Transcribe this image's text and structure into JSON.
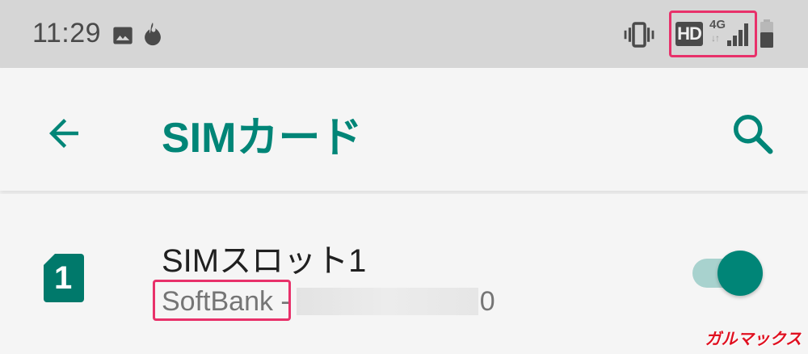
{
  "status_bar": {
    "time": "11:29",
    "icons": [
      "image-icon",
      "flame-icon",
      "vibrate-icon",
      "hd-icon",
      "signal-icon",
      "battery-icon"
    ],
    "hd_label": "HD",
    "network_label": "4G",
    "data_arrows": "↓↑"
  },
  "toolbar": {
    "title": "SIMカード",
    "back_icon": "arrow-back-icon",
    "search_icon": "search-icon"
  },
  "sim_slot": {
    "title": "SIMスロット1",
    "badge_number": "1",
    "carrier": "SoftBank",
    "separator": " -",
    "number_suffix": "0",
    "enabled": true
  },
  "watermark": "ガルマックス",
  "colors": {
    "accent": "#008577",
    "highlight": "#e8316a",
    "toggle_track": "#a8d2ce"
  }
}
